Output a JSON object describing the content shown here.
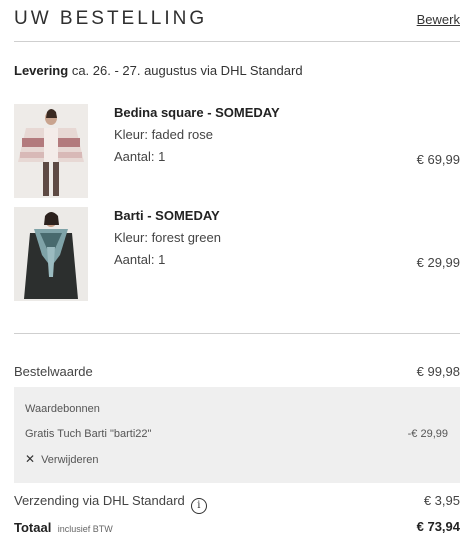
{
  "header": {
    "title": "UW BESTELLING",
    "edit_label": "Bewerk"
  },
  "delivery": {
    "label": "Levering",
    "text": "ca. 26. - 27. augustus via DHL Standard"
  },
  "items": [
    {
      "name": "Bedina square - SOMEDAY",
      "color_line": "Kleur: faded rose",
      "qty_line": "Aantal: 1",
      "price": "€ 69,99",
      "image_icon": "product-photo-poncho"
    },
    {
      "name": "Barti - SOMEDAY",
      "color_line": "Kleur: forest green",
      "qty_line": "Aantal: 1",
      "price": "€ 29,99",
      "image_icon": "product-photo-scarf"
    }
  ],
  "summary": {
    "subtotal_label": "Bestelwaarde",
    "subtotal_value": "€ 99,98",
    "voucher_heading": "Waardebonnen",
    "voucher_name": "Gratis Tuch Barti \"barti22\"",
    "voucher_amount": "-€ 29,99",
    "remove_label": "Verwijderen",
    "shipping_label": "Verzending via DHL Standard",
    "shipping_value": "€ 3,95",
    "total_label": "Totaal",
    "total_sub": "inclusief BTW",
    "total_value": "€ 73,94"
  },
  "colors": {
    "divider": "#cfcfcf",
    "voucher_bg": "#efefef",
    "text": "#2b2b2b"
  }
}
